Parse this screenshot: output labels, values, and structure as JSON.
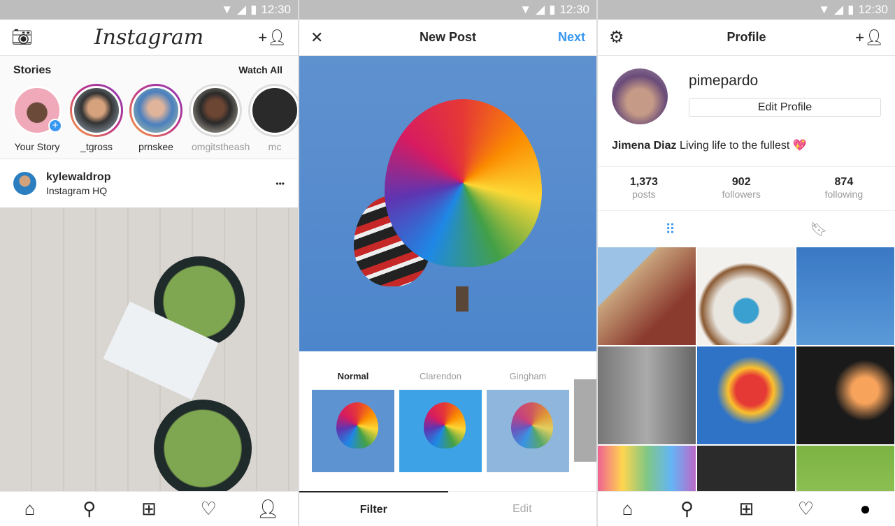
{
  "status": {
    "time": "12:30"
  },
  "feed": {
    "logo": "Instagram",
    "stories_label": "Stories",
    "watch_all": "Watch All",
    "stories": [
      {
        "name": "Your Story"
      },
      {
        "name": "_tgross"
      },
      {
        "name": "prnskee"
      },
      {
        "name": "omgitstheash"
      },
      {
        "name": "mc"
      }
    ],
    "post": {
      "username": "kylewaldrop",
      "location": "Instagram HQ",
      "more": "•••"
    }
  },
  "new_post": {
    "title": "New Post",
    "next": "Next",
    "filters": [
      "Normal",
      "Clarendon",
      "Gingham"
    ],
    "selected_filter": "Normal",
    "tabs": [
      "Filter",
      "Edit"
    ],
    "active_tab": "Filter"
  },
  "profile": {
    "title": "Profile",
    "username": "pimepardo",
    "edit_button": "Edit Profile",
    "full_name": "Jimena Diaz",
    "bio": "Living life to the fullest 💖",
    "stats": [
      {
        "value": "1,373",
        "label": "posts"
      },
      {
        "value": "902",
        "label": "followers"
      },
      {
        "value": "874",
        "label": "following"
      }
    ]
  },
  "colors": {
    "accent": "#3897f0",
    "text": "#262626",
    "muted": "#999999"
  }
}
